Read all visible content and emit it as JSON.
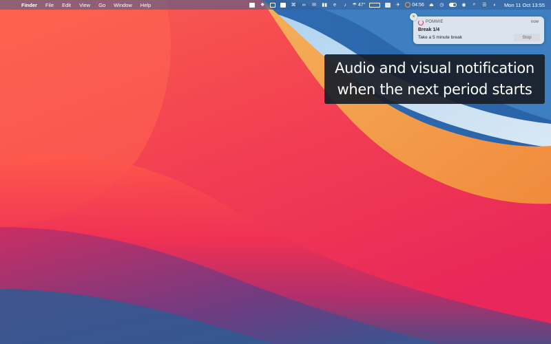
{
  "menubar": {
    "apple_icon": "apple-icon",
    "menus": [
      "Finder",
      "File",
      "Edit",
      "View",
      "Go",
      "Window",
      "Help"
    ],
    "status_items": {
      "weather": "47°",
      "timer": "04:56",
      "clock": "Mon 11 Oct  13:55"
    }
  },
  "notification": {
    "app_name": "POMMIE",
    "time": "now",
    "title": "Break 1/4",
    "body": "Take a 5 minute break",
    "action": "Stop",
    "close_glyph": "×",
    "app_color": "#d8334a"
  },
  "caption": {
    "line1": "Audio and visual notification",
    "line2": "when the next period starts"
  },
  "colors": {
    "desktop_blue": "#3a5e96",
    "desktop_red": "#f23c52",
    "desktop_orange": "#f7a24a"
  }
}
